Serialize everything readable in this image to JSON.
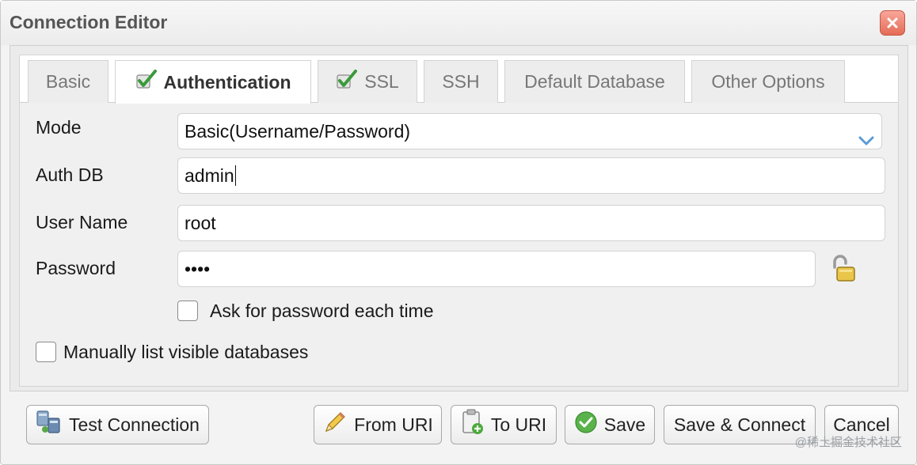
{
  "window": {
    "title": "Connection Editor",
    "close_icon": "close-icon"
  },
  "tabs": [
    {
      "label": "Basic",
      "checked": false,
      "active": false
    },
    {
      "label": "Authentication",
      "checked": true,
      "active": true
    },
    {
      "label": "SSL",
      "checked": true,
      "active": false
    },
    {
      "label": "SSH",
      "checked": false,
      "active": false
    },
    {
      "label": "Default Database",
      "checked": false,
      "active": false
    },
    {
      "label": "Other Options",
      "checked": false,
      "active": false
    }
  ],
  "form": {
    "mode_label": "Mode",
    "mode_value": "Basic(Username/Password)",
    "auth_db_label": "Auth DB",
    "auth_db_value": "admin",
    "username_label": "User Name",
    "username_value": "root",
    "password_label": "Password",
    "password_value": "••••",
    "ask_password_label": "Ask for password each time",
    "ask_password_checked": false,
    "manual_dbs_label": "Manually list visible databases",
    "manual_dbs_checked": false
  },
  "buttons": {
    "test_connection": "Test Connection",
    "from_uri": "From URI",
    "to_uri": "To URI",
    "save": "Save",
    "save_connect": "Save & Connect",
    "cancel": "Cancel"
  },
  "watermark": "@稀土掘金技术社区",
  "colors": {
    "close_button": "#e46b57",
    "check_green": "#3a9a3a",
    "chevron_blue": "#5b9bd5"
  }
}
